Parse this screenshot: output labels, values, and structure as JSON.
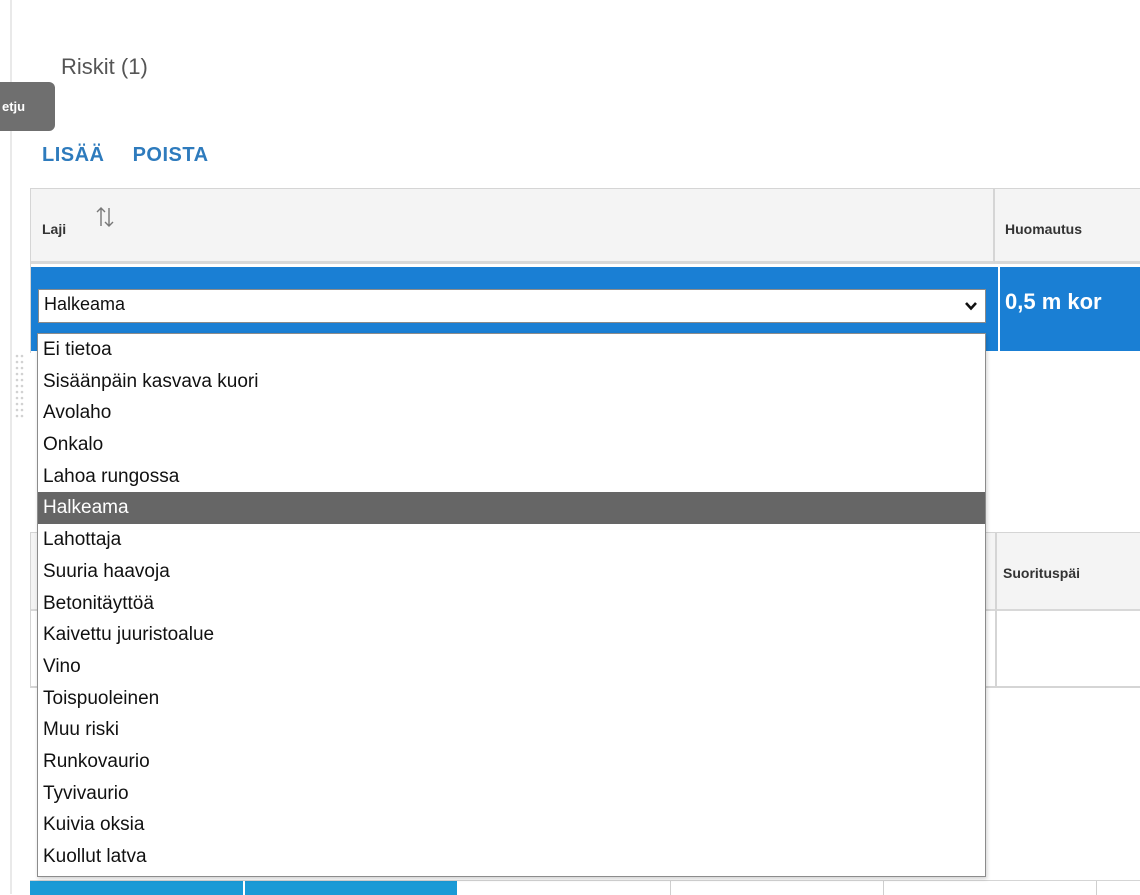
{
  "tooltip_tab": {
    "label": "etju"
  },
  "section": {
    "title": "Riskit (1)"
  },
  "actions": {
    "add_label": "LISÄÄ",
    "remove_label": "POISTA"
  },
  "table": {
    "columns": [
      {
        "label": "Laji"
      },
      {
        "label": "Huomautus"
      }
    ],
    "row": {
      "laji_value": "Halkeama",
      "note_value": "0,5 m kor"
    }
  },
  "dropdown": {
    "options": [
      "Ei tietoa",
      "Sisäänpäin kasvava kuori",
      "Avolaho",
      "Onkalo",
      "Lahoa rungossa",
      "Halkeama",
      "Lahottaja",
      "Suuria haavoja",
      "Betonitäyttöä",
      "Kaivettu juuristoalue",
      "Vino",
      "Toispuoleinen",
      "Muu riski",
      "Runkovaurio",
      "Tyvivaurio",
      "Kuivia oksia",
      "Kuollut latva"
    ],
    "selected": "Halkeama"
  },
  "table2": {
    "column_label": "Suorituspäi"
  },
  "colors": {
    "accent": "#1a7fd4",
    "link": "#2e7bbd",
    "selected_option": "#666666"
  }
}
